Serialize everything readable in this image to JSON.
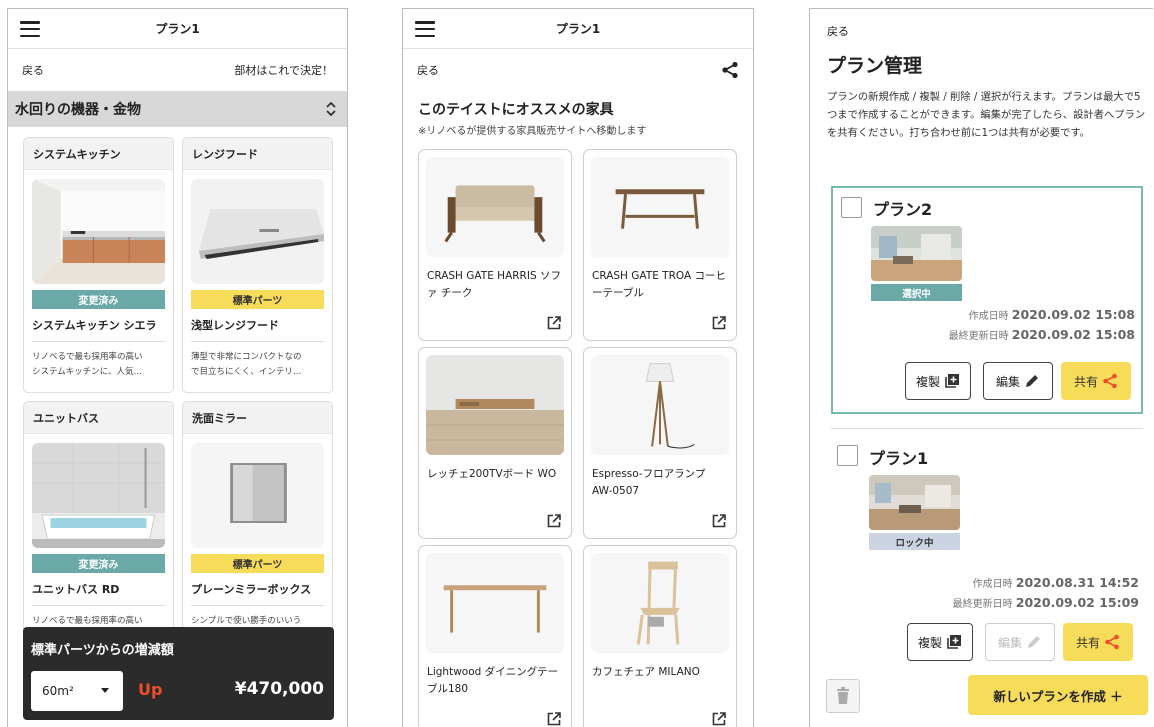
{
  "screen1": {
    "title": "プラン1",
    "back": "戻る",
    "decide": "部材はこれで決定！",
    "section": "水回りの機器・金物",
    "cards": [
      {
        "category": "システムキッチン",
        "badge": "変更済み",
        "name": "システムキッチン シエラ",
        "desc1": "リノベるで最も採用率の高い",
        "desc2": "システムキッチンに、人気…"
      },
      {
        "category": "レンジフード",
        "badge": "標準パーツ",
        "name": "浅型レンジフード",
        "desc1": "薄型で非常にコンパクトなの",
        "desc2": "で目立ちにくく、インテリ…"
      },
      {
        "category": "ユニットバス",
        "badge": "変更済み",
        "name": "ユニットバス RD",
        "desc1": "リノべるで最も採用率の高い",
        "desc2": ""
      },
      {
        "category": "洗面ミラー",
        "badge": "標準パーツ",
        "name": "プレーンミラーボックス",
        "desc1": "シンプルで使い勝手のいいう",
        "desc2": ""
      }
    ],
    "footer": {
      "title": "標準パーツからの増減額",
      "select": "60m²",
      "direction": "Up",
      "amount": "¥470,000"
    }
  },
  "screen2": {
    "title": "プラン1",
    "back": "戻る",
    "heading": "このテイストにオススメの家具",
    "note": "※リノベるが提供する家具販売サイトへ移動します",
    "items": [
      {
        "name": "CRASH GATE HARRIS ソファ チーク"
      },
      {
        "name": "CRASH GATE TROA コーヒーテーブル"
      },
      {
        "name": "レッチェ200TVボード WO"
      },
      {
        "name": "Espresso-フロアランプ AW-0507"
      },
      {
        "name": "Lightwood ダイニングテーブル180"
      },
      {
        "name": "カフェチェア MILANO"
      }
    ]
  },
  "screen3": {
    "back": "戻る",
    "heading": "プラン管理",
    "desc": "プランの新規作成 / 複製 / 削除 / 選択が行えます。プランは最大で5つまで作成することができます。編集が完了したら、設計者へプランを共有ください。打ち合わせ前に1つは共有が必要です。",
    "plans": [
      {
        "name": "プラン2",
        "badge": "選択中",
        "created_label": "作成日時",
        "created": "2020.09.02 15:08",
        "updated_label": "最終更新日時",
        "updated": "2020.09.02 15:08"
      },
      {
        "name": "プラン1",
        "badge": "ロック中",
        "created_label": "作成日時",
        "created": "2020.08.31 14:52",
        "updated_label": "最終更新日時",
        "updated": "2020.09.02 15:09"
      }
    ],
    "buttons": {
      "copy": "複製",
      "edit": "編集",
      "share": "共有",
      "new_plan": "新しいプランを作成 ＋"
    },
    "colors": {
      "selected_border": "#76b9b3",
      "accent_yellow": "#f7dc5a",
      "teal": "#6aa9a7"
    }
  }
}
